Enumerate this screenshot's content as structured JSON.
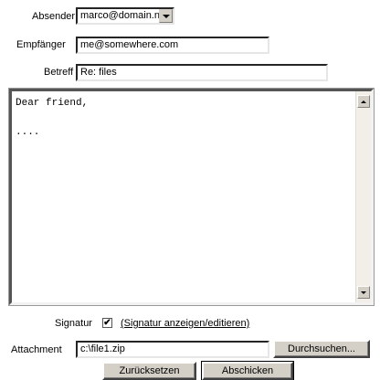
{
  "form": {
    "sender_label": "Absender",
    "sender_value": "marco@domain.nic",
    "recipient_label": "Empfänger",
    "recipient_value": "me@somewhere.com",
    "subject_label": "Betreff",
    "subject_value": "Re: files",
    "body_text": "Dear friend,\n\n....",
    "signature_label": "Signatur",
    "signature_checked": true,
    "signature_check_glyph": "✔",
    "signature_link": "(Signatur anzeigen/editieren)",
    "attachment_label": "Attachment",
    "attachment_value": "c:\\file1.zip",
    "browse_button": "Durchsuchen...",
    "reset_button": "Zurücksetzen",
    "send_button": "Abschicken"
  }
}
